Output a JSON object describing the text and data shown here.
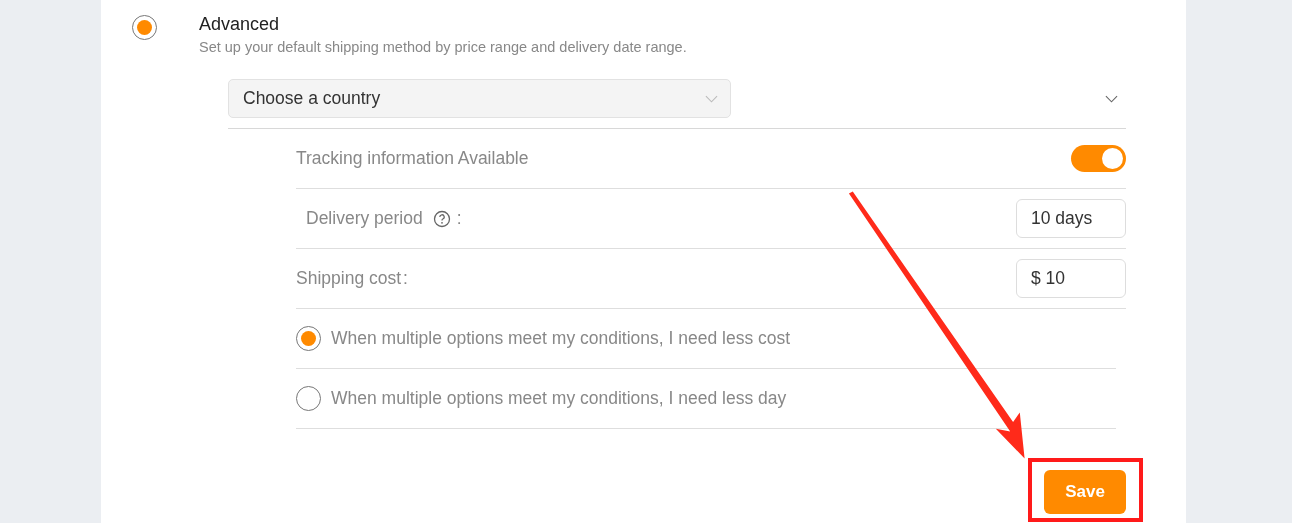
{
  "mode": {
    "title": "Advanced",
    "description": "Set up your default shipping method by price range and delivery date range.",
    "selected": true
  },
  "country_select": {
    "placeholder": "Choose a country"
  },
  "section": {
    "expanded": true
  },
  "tracking": {
    "label": "Tracking information Available",
    "on": true
  },
  "fields": [
    {
      "label": "Delivery period",
      "has_help": true,
      "colon": ":",
      "value": "10 days"
    },
    {
      "label": "Shipping cost",
      "has_help": false,
      "colon": ":",
      "value": "$ 10"
    }
  ],
  "preferences": [
    {
      "label": "When multiple options meet my conditions, I need less cost",
      "selected": true
    },
    {
      "label": "When multiple options meet my conditions, I need less day",
      "selected": false
    }
  ],
  "save_button": {
    "label": "Save",
    "highlighted": true
  }
}
